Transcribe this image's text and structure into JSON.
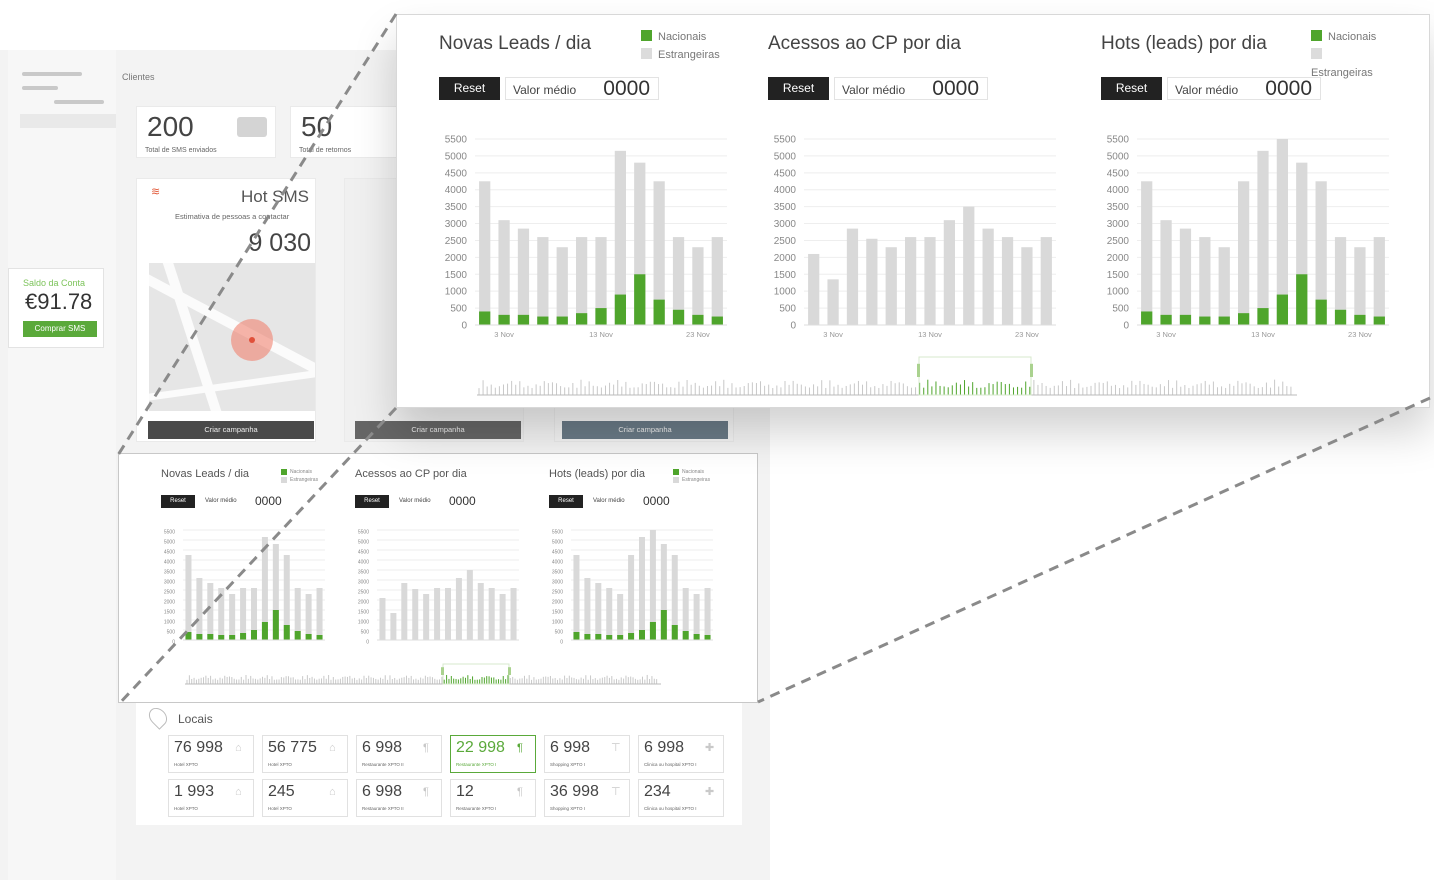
{
  "app": {
    "breadcrumb": "Clientes",
    "balance": {
      "label": "Saldo da Conta",
      "amount": "€91.78",
      "button": "Comprar SMS"
    }
  },
  "stats": [
    {
      "value": "200",
      "label": "Total de SMS enviados"
    },
    {
      "value": "50",
      "label": "Total de retornos"
    }
  ],
  "hot_sms": {
    "title": "Hot SMS",
    "subtitle": "Estimativa de pessoas a contactar",
    "value": "9 030",
    "button": "Criar campanha"
  },
  "campaign_buttons": [
    "Criar campanha",
    "Criar campanha"
  ],
  "colors": {
    "nacionais": "#4fa52c",
    "estrangeiras": "#d9d9d9",
    "accent": "#5aa93a"
  },
  "legend": {
    "nacionais": "Nacionais",
    "estrangeiras": "Estrangeiras"
  },
  "controls": {
    "reset": "Reset",
    "avg_label": "Valor médio",
    "avg_value": "0000"
  },
  "chart_data": [
    {
      "type": "bar",
      "title": "Novas Leads / dia",
      "y_ticks": [
        "5500",
        "5000",
        "4500",
        "4000",
        "3500",
        "3000",
        "2500",
        "2000",
        "1500",
        "1000",
        "500",
        "0"
      ],
      "ylim": [
        0,
        5500
      ],
      "x_tick_labels": [
        "3 Nov",
        "13 Nov",
        "23 Nov"
      ],
      "series": [
        {
          "name": "Nacionais",
          "values": [
            400,
            300,
            300,
            250,
            250,
            350,
            500,
            900,
            1500,
            750,
            450,
            300,
            250
          ]
        },
        {
          "name": "Estrangeiras",
          "values": [
            4250,
            3100,
            2850,
            2600,
            2300,
            2600,
            2600,
            5150,
            4800,
            4250,
            2600,
            2300,
            2600
          ]
        }
      ]
    },
    {
      "type": "bar",
      "title": "Acessos ao CP por dia",
      "y_ticks": [
        "5500",
        "5000",
        "4500",
        "4000",
        "3500",
        "3000",
        "2500",
        "2000",
        "1500",
        "1000",
        "500",
        "0"
      ],
      "ylim": [
        0,
        5500
      ],
      "x_tick_labels": [
        "3 Nov",
        "13 Nov",
        "23 Nov"
      ],
      "series": [
        {
          "name": "Estrangeiras",
          "values": [
            2100,
            1350,
            2850,
            2550,
            2300,
            2600,
            2600,
            3100,
            3500,
            2850,
            2600,
            2300,
            2600
          ]
        }
      ]
    },
    {
      "type": "bar",
      "title": "Hots (leads) por dia",
      "y_ticks": [
        "5500",
        "5000",
        "4500",
        "4000",
        "3500",
        "3000",
        "2500",
        "2000",
        "1500",
        "1000",
        "500",
        "0"
      ],
      "ylim": [
        0,
        5500
      ],
      "x_tick_labels": [
        "3 Nov",
        "13 Nov",
        "23 Nov"
      ],
      "series": [
        {
          "name": "Nacionais",
          "values": [
            400,
            300,
            300,
            250,
            250,
            350,
            500,
            900,
            1500,
            750,
            450,
            300,
            250
          ]
        },
        {
          "name": "Estrangeiras",
          "values": [
            4250,
            3100,
            2850,
            2600,
            2300,
            4250,
            5150,
            5500,
            4800,
            4250,
            2600,
            2300,
            2600
          ]
        }
      ]
    }
  ],
  "locais": {
    "title": "Locais",
    "items": [
      {
        "value": "76 998",
        "label": "Hotel XPTO",
        "icon": "hotel-icon"
      },
      {
        "value": "56 775",
        "label": "Hotel XPTO",
        "icon": "hotel-icon"
      },
      {
        "value": "6 998",
        "label": "Restaurante XPTO II",
        "icon": "restaurant-icon"
      },
      {
        "value": "22 998",
        "label": "Restaurante XPTO I",
        "icon": "restaurant-icon",
        "highlight": true
      },
      {
        "value": "6 998",
        "label": "Shopping XPTO I",
        "icon": "shopping-icon"
      },
      {
        "value": "6 998",
        "label": "Clinica ou hospital XPTO I",
        "icon": "clinic-icon"
      },
      {
        "value": "1 993",
        "label": "Hotel XPTO",
        "icon": "hotel-icon"
      },
      {
        "value": "245",
        "label": "Hotel XPTO",
        "icon": "hotel-icon"
      },
      {
        "value": "6 998",
        "label": "Restaurante XPTO II",
        "icon": "restaurant-icon"
      },
      {
        "value": "12",
        "label": "Restaurante XPTO I",
        "icon": "restaurant-icon"
      },
      {
        "value": "36 998",
        "label": "Shopping XPTO I",
        "icon": "shopping-icon"
      },
      {
        "value": "234",
        "label": "Clinica ou hospital XPTO I",
        "icon": "clinic-icon"
      }
    ]
  }
}
